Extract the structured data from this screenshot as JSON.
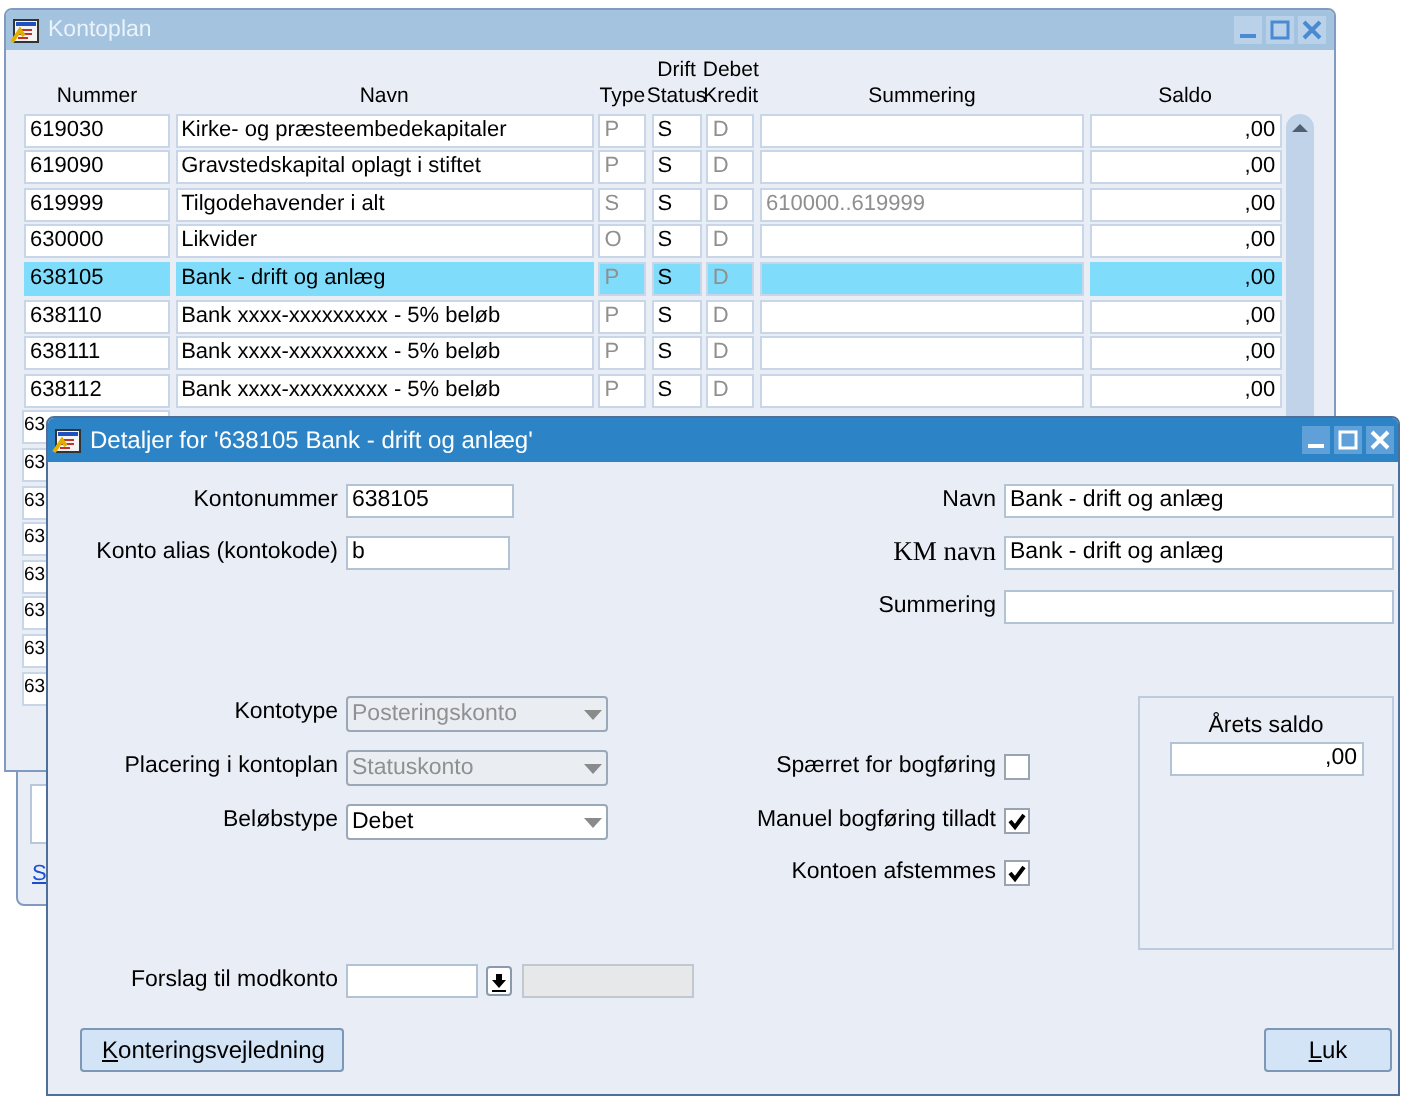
{
  "list_window": {
    "title": "Kontoplan",
    "columns": [
      "Nummer",
      "Navn",
      "Type",
      "Drift Status",
      "Debet Kredit",
      "Summering",
      "Saldo"
    ],
    "rows": [
      {
        "number": "619030",
        "name": "Kirke- og præsteembedekapitaler",
        "type": "P",
        "status": "S",
        "debit_credit": "D",
        "summering": "",
        "saldo": ",00",
        "selected": false
      },
      {
        "number": "619090",
        "name": "Gravstedskapital oplagt i stiftet",
        "type": "P",
        "status": "S",
        "debit_credit": "D",
        "summering": "",
        "saldo": ",00",
        "selected": false
      },
      {
        "number": "619999",
        "name": "Tilgodehavender i alt",
        "type": "S",
        "status": "S",
        "debit_credit": "D",
        "summering": "610000..619999",
        "saldo": ",00",
        "selected": false
      },
      {
        "number": "630000",
        "name": "Likvider",
        "type": "O",
        "status": "S",
        "debit_credit": "D",
        "summering": "",
        "saldo": ",00",
        "selected": false
      },
      {
        "number": "638105",
        "name": "Bank - drift og anlæg",
        "type": "P",
        "status": "S",
        "debit_credit": "D",
        "summering": "",
        "saldo": ",00",
        "selected": true
      },
      {
        "number": "638110",
        "name": "Bank xxxx-xxxxxxxxx - 5% beløb",
        "type": "P",
        "status": "S",
        "debit_credit": "D",
        "summering": "",
        "saldo": ",00",
        "selected": false
      },
      {
        "number": "638111",
        "name": "Bank xxxx-xxxxxxxxx - 5% beløb",
        "type": "P",
        "status": "S",
        "debit_credit": "D",
        "summering": "",
        "saldo": ",00",
        "selected": false
      },
      {
        "number": "638112",
        "name": "Bank xxxx-xxxxxxxxx - 5% beløb",
        "type": "P",
        "status": "S",
        "debit_credit": "D",
        "summering": "",
        "saldo": ",00",
        "selected": false
      }
    ],
    "partial_rows": [
      "63",
      "63",
      "63",
      "63",
      "63",
      "63",
      "63",
      "63"
    ]
  },
  "background_window": {
    "link": "S"
  },
  "detail_dialog": {
    "title": "Detaljer for '638105 Bank - drift og anlæg'",
    "left_fields": [
      {
        "label": "Kontonummer",
        "value": "638105"
      },
      {
        "label": "Konto alias (kontokode)",
        "value": "b"
      }
    ],
    "right_fields": [
      {
        "label": "Navn",
        "value": "Bank - drift og anlæg"
      },
      {
        "label": "KM navn",
        "value": "Bank - drift og anlæg"
      },
      {
        "label": "Summering"
      }
    ],
    "selects": [
      {
        "label": "Kontotype",
        "value": "Posteringskonto",
        "disabled": true
      },
      {
        "label": "Placering i kontoplan",
        "value": "Statuskonto",
        "disabled": true
      },
      {
        "label": "Beløbstype",
        "value": "Debet",
        "disabled": false
      }
    ],
    "checkboxes": [
      {
        "label": "Spærret for bogføring",
        "checked": false
      },
      {
        "label": "Manuel bogføring tilladt",
        "checked": true
      },
      {
        "label": "Kontoen afstemmes",
        "checked": true
      }
    ],
    "saldo_panel": {
      "label": "Årets saldo",
      "value": ",00"
    },
    "modkonto": {
      "label": "Forslag til modkonto"
    },
    "buttons": [
      "Konteringsvejledning",
      "Luk"
    ]
  }
}
